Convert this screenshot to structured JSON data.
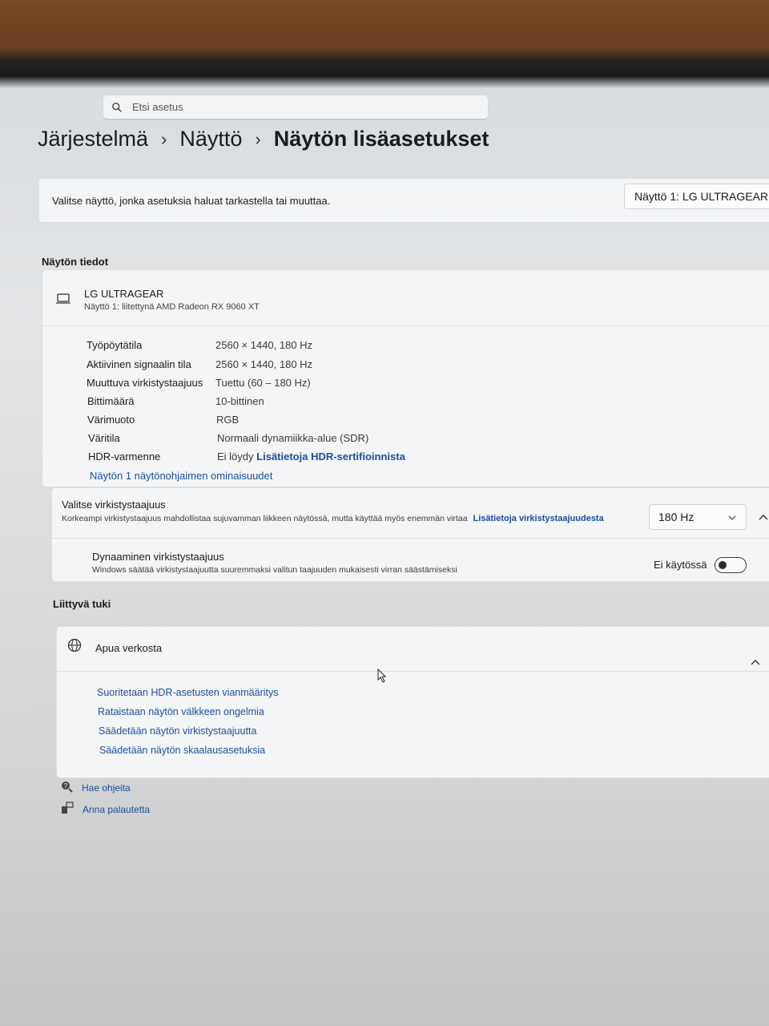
{
  "search": {
    "placeholder": "Etsi asetus"
  },
  "breadcrumb": {
    "items": [
      "Järjestelmä",
      "Näyttö",
      "Näytön lisäasetukset"
    ]
  },
  "display_select": {
    "prompt": "Valitse näyttö, jonka asetuksia haluat tarkastella tai muuttaa.",
    "selected": "Näyttö 1: LG ULTRAGEAR"
  },
  "display_info": {
    "section_title": "Näytön tiedot",
    "monitor_name": "LG ULTRAGEAR",
    "monitor_sub": "Näyttö 1: liitettynä AMD Radeon RX 9060 XT",
    "properties": [
      {
        "label": "Työpöytätila",
        "value": "2560 × 1440, 180 Hz"
      },
      {
        "label": "Aktiivinen signaalin tila",
        "value": "2560 × 1440, 180 Hz"
      },
      {
        "label": "Muuttuva virkistystaajuus",
        "value": "Tuettu (60 – 180 Hz)"
      },
      {
        "label": "Bittimäärä",
        "value": "10-bittinen"
      },
      {
        "label": "Värimuoto",
        "value": "RGB"
      },
      {
        "label": "Väritila",
        "value": "Normaali dynamiikka-alue (SDR)"
      },
      {
        "label": "HDR-varmenne",
        "value": "Ei löydy",
        "link": "Lisätietoja HDR-sertifioinnista"
      }
    ],
    "adapter_link": "Näytön 1 näytönohjaimen ominaisuudet"
  },
  "refresh_rate": {
    "title": "Valitse virkistystaajuus",
    "description": "Korkeampi virkistystaajuus mahdollistaa sujuvamman liikkeen näytössä, mutta käyttää myös enemmän virtaa",
    "link": "Lisätietoja virkistystaajuudesta",
    "selected": "180 Hz",
    "dynamic_title": "Dynaaminen virkistystaajuus",
    "dynamic_description": "Windows säätää virkistystaajuutta suuremmaksi valitun taajuuden mukaisesti virran säästämiseksi",
    "dynamic_state": "Ei käytössä",
    "dynamic_on": false
  },
  "related": {
    "section_title": "Liittyvä tuki",
    "help_title": "Apua verkosta",
    "links": [
      "Suoritetaan HDR-asetusten vianmääritys",
      "Rataistaan näytön välkkeen ongelmia",
      "Säädetään näytön virkistystaajuutta",
      "Säädetään näytön skaalausasetuksia"
    ]
  },
  "footer": {
    "get_help": "Hae ohjeita",
    "feedback": "Anna palautetta"
  }
}
